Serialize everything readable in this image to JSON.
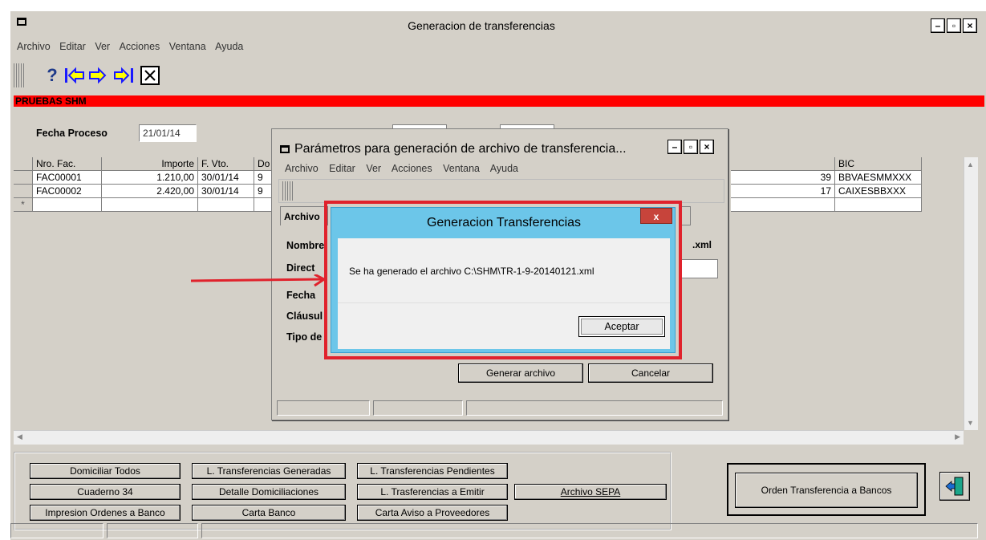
{
  "window": {
    "title": "Generacion de transferencias",
    "menu": [
      "Archivo",
      "Editar",
      "Ver",
      "Acciones",
      "Ventana",
      "Ayuda"
    ],
    "company": "PRUEBAS SHM"
  },
  "toolbar": {
    "help": "?",
    "icons": [
      "help-icon",
      "first-record-icon",
      "next-record-icon",
      "last-record-icon",
      "close-x-icon"
    ]
  },
  "filters": {
    "fecha_label": "Fecha Proceso",
    "fecha_value": "21/01/14"
  },
  "grid": {
    "headers": [
      "Nro. Fac.",
      "Importe",
      "F. Vto.",
      "Do",
      "",
      "BIC"
    ],
    "rows": [
      {
        "nro": "FAC00001",
        "importe": "1.210,00",
        "fvto": "30/01/14",
        "do": "9",
        "num": "39",
        "bic": "BBVAESMMXXX"
      },
      {
        "nro": "FAC00002",
        "importe": "2.420,00",
        "fvto": "30/01/14",
        "do": "9",
        "num": "17",
        "bic": "CAIXESBBXXX"
      }
    ],
    "new_row_marker": "*"
  },
  "buttons": {
    "domiciliar_todos": "Domiciliar Todos",
    "cuaderno_34": "Cuaderno 34",
    "impresion_ordenes": "Impresion Ordenes a Banco",
    "l_transf_generadas": "L. Transferencias Generadas",
    "detalle_domiciliaciones": "Detalle Domiciliaciones",
    "carta_banco": "Carta Banco",
    "l_transf_pendientes": "L. Transferencias Pendientes",
    "l_trasf_emitir": "L. Trasferencias a Emitir",
    "carta_aviso": "Carta Aviso a Proveedores",
    "archivo_sepa": "Archivo SEPA",
    "orden_transferencia": "Orden Transferencia a Bancos"
  },
  "param_dialog": {
    "title": "Parámetros para generación de archivo de transferencia...",
    "menu": [
      "Archivo",
      "Editar",
      "Ver",
      "Acciones",
      "Ventana",
      "Ayuda"
    ],
    "tab_label": "Archivo",
    "labels": [
      "Nombre",
      "Direct",
      "Fecha",
      "Cláusul",
      "Tipo de"
    ],
    "ext": ".xml",
    "generar": "Generar archivo",
    "cancelar": "Cancelar"
  },
  "message_dialog": {
    "title": "Generacion Transferencias",
    "close": "x",
    "text": "Se ha generado el archivo C:\\SHM\\TR-1-9-20140121.xml",
    "ok": "Aceptar"
  },
  "annotation": {
    "frame_color": "#e0222c",
    "arrow_color": "#e0222c"
  }
}
